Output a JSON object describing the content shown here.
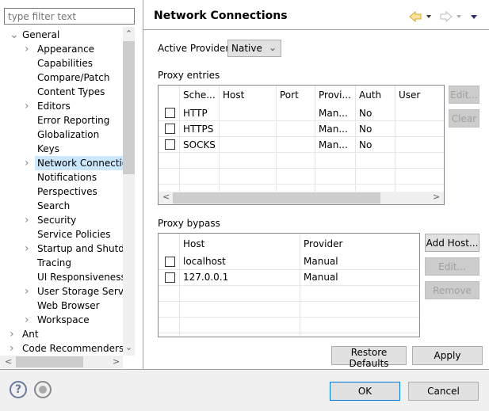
{
  "filter": {
    "placeholder": "type filter text"
  },
  "tree": [
    {
      "label": "General",
      "level": 0,
      "expander": "expanded"
    },
    {
      "label": "Appearance",
      "level": 1,
      "expander": "collapsed"
    },
    {
      "label": "Capabilities",
      "level": 1
    },
    {
      "label": "Compare/Patch",
      "level": 1
    },
    {
      "label": "Content Types",
      "level": 1
    },
    {
      "label": "Editors",
      "level": 1,
      "expander": "collapsed"
    },
    {
      "label": "Error Reporting",
      "level": 1
    },
    {
      "label": "Globalization",
      "level": 1
    },
    {
      "label": "Keys",
      "level": 1
    },
    {
      "label": "Network Connections",
      "level": 1,
      "expander": "collapsed",
      "selected": true
    },
    {
      "label": "Notifications",
      "level": 1
    },
    {
      "label": "Perspectives",
      "level": 1
    },
    {
      "label": "Search",
      "level": 1
    },
    {
      "label": "Security",
      "level": 1,
      "expander": "collapsed"
    },
    {
      "label": "Service Policies",
      "level": 1
    },
    {
      "label": "Startup and Shutdown",
      "level": 1,
      "expander": "collapsed"
    },
    {
      "label": "Tracing",
      "level": 1
    },
    {
      "label": "UI Responsiveness Monitoring",
      "level": 1
    },
    {
      "label": "User Storage Service",
      "level": 1,
      "expander": "collapsed"
    },
    {
      "label": "Web Browser",
      "level": 1
    },
    {
      "label": "Workspace",
      "level": 1,
      "expander": "collapsed"
    },
    {
      "label": "Ant",
      "level": 0,
      "expander": "collapsed"
    },
    {
      "label": "Code Recommenders",
      "level": 0,
      "expander": "collapsed"
    }
  ],
  "page": {
    "title": "Network Connections",
    "active_provider_label": "Active Provider:",
    "active_provider_value": "Native"
  },
  "proxy_entries": {
    "label": "Proxy entries",
    "columns": [
      "Sche...",
      "Host",
      "Port",
      "Provi...",
      "Auth",
      "User"
    ],
    "rows": [
      [
        "HTTP",
        "",
        "",
        "Man...",
        "No",
        ""
      ],
      [
        "HTTPS",
        "",
        "",
        "Man...",
        "No",
        ""
      ],
      [
        "SOCKS",
        "",
        "",
        "Man...",
        "No",
        ""
      ]
    ],
    "edit": "Edit...",
    "clear": "Clear"
  },
  "proxy_bypass": {
    "label": "Proxy bypass",
    "columns": [
      "Host",
      "Provider"
    ],
    "rows": [
      [
        "localhost",
        "Manual"
      ],
      [
        "127.0.0.1",
        "Manual"
      ]
    ],
    "add": "Add Host...",
    "edit": "Edit...",
    "remove": "Remove"
  },
  "buttons": {
    "restore": "Restore Defaults",
    "apply": "Apply",
    "ok": "OK",
    "cancel": "Cancel",
    "help_glyph": "?"
  },
  "colors": {
    "selection": "#cce8ff",
    "default_button_border": "#0078d7",
    "back_arrow": "#e8b84a"
  }
}
